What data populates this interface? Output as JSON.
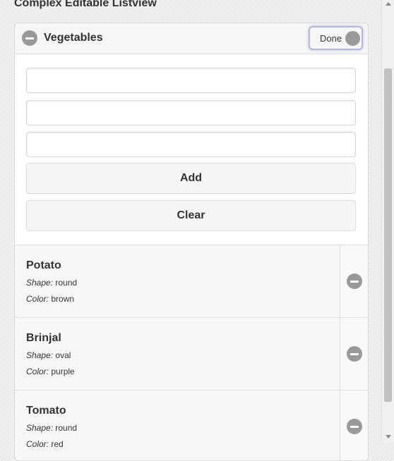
{
  "page": {
    "title": "Complex Editable Listview"
  },
  "panel": {
    "title": "Vegetables",
    "done_label": "Done"
  },
  "form": {
    "inputs": [
      {
        "value": "",
        "placeholder": ""
      },
      {
        "value": "",
        "placeholder": ""
      },
      {
        "value": "",
        "placeholder": ""
      }
    ],
    "add_label": "Add",
    "clear_label": "Clear"
  },
  "list": {
    "items": [
      {
        "title": "Potato",
        "shape_label": "Shape:",
        "shape": "round",
        "color_label": "Color:",
        "color": "brown"
      },
      {
        "title": "Brinjal",
        "shape_label": "Shape:",
        "shape": "oval",
        "color_label": "Color:",
        "color": "purple"
      },
      {
        "title": "Tomato",
        "shape_label": "Shape:",
        "shape": "round",
        "color_label": "Color:",
        "color": "red"
      }
    ]
  },
  "icons": {
    "header": "minus-circle-icon",
    "done": "circle-icon",
    "delete": "minus-circle-icon"
  },
  "colors": {
    "icon_gray": "#999999",
    "done_border": "#b4b8dc",
    "text": "#333333"
  }
}
